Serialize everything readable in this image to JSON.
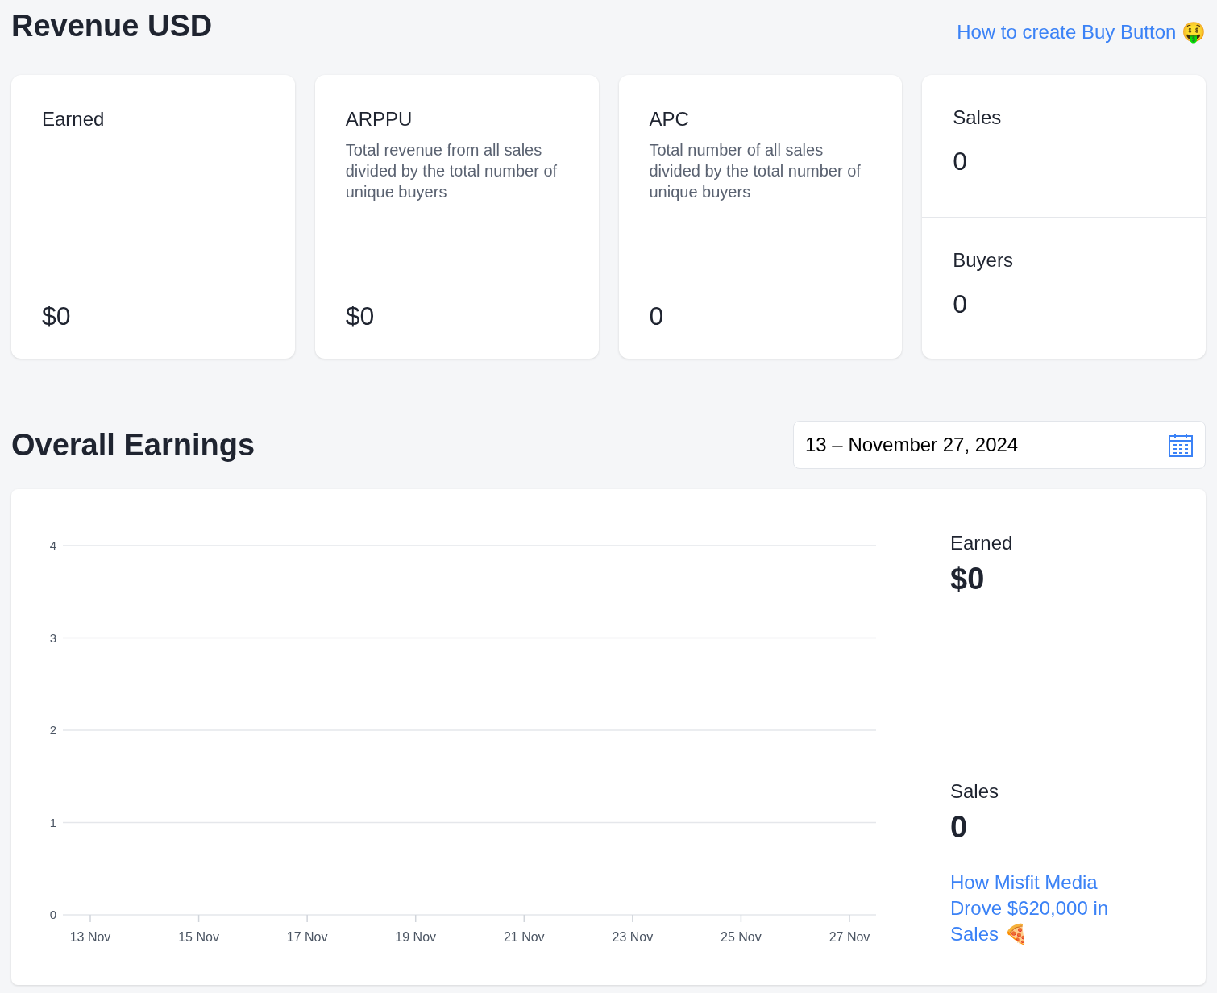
{
  "header": {
    "title": "Revenue USD",
    "link": "How to create Buy Button 🤑"
  },
  "stats": [
    {
      "kind": "single",
      "label": "Earned",
      "value": "$0"
    },
    {
      "kind": "single",
      "label": "ARPPU",
      "description": "Total revenue from all sales divided by the total number of unique buyers",
      "value": "$0"
    },
    {
      "kind": "single",
      "label": "APC",
      "description": "Total number of all sales divided by the total number of unique buyers",
      "value": "0"
    },
    {
      "kind": "split",
      "items": [
        {
          "label": "Sales",
          "value": "0"
        },
        {
          "label": "Buyers",
          "value": "0"
        }
      ]
    }
  ],
  "earnings": {
    "title": "Overall Earnings",
    "date_range": "13 – November 27, 2024",
    "chart_data": {
      "type": "line",
      "x": [
        "13 Nov",
        "15 Nov",
        "17 Nov",
        "19 Nov",
        "21 Nov",
        "23 Nov",
        "25 Nov",
        "27 Nov"
      ],
      "ylim": [
        0,
        4
      ],
      "yticks": [
        0,
        1,
        2,
        3,
        4
      ],
      "grid": true
    },
    "summary": [
      {
        "label": "Earned",
        "value": "$0"
      },
      {
        "label": "Sales",
        "value": "0"
      }
    ],
    "link": "How Misfit Media Drove $620,000 in Sales 🍕"
  }
}
